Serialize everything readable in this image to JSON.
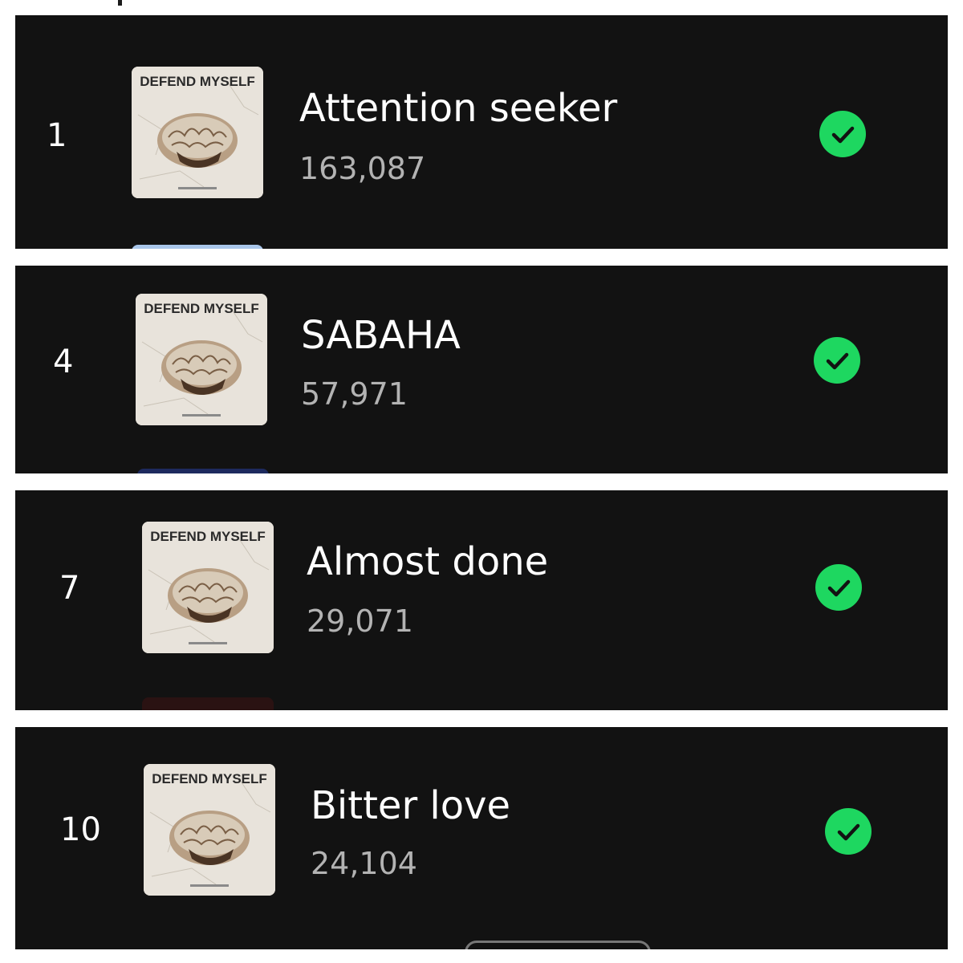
{
  "tracks": [
    {
      "rank": "1",
      "title": "Attention seeker",
      "plays": "163,087",
      "album_art_text": "DEFEND MYSELF",
      "status_icon": "check-circle-icon"
    },
    {
      "rank": "4",
      "title": "SABAHA",
      "plays": "57,971",
      "album_art_text": "DEFEND MYSELF",
      "status_icon": "check-circle-icon"
    },
    {
      "rank": "7",
      "title": "Almost done",
      "plays": "29,071",
      "album_art_text": "DEFEND MYSELF",
      "status_icon": "check-circle-icon"
    },
    {
      "rank": "10",
      "title": "Bitter love",
      "plays": "24,104",
      "album_art_text": "DEFEND MYSELF",
      "status_icon": "check-circle-icon"
    }
  ],
  "colors": {
    "background": "#121212",
    "title": "#ffffff",
    "plays": "#b3b3b3",
    "accent": "#1ed760",
    "gutter": "#ffffff"
  }
}
